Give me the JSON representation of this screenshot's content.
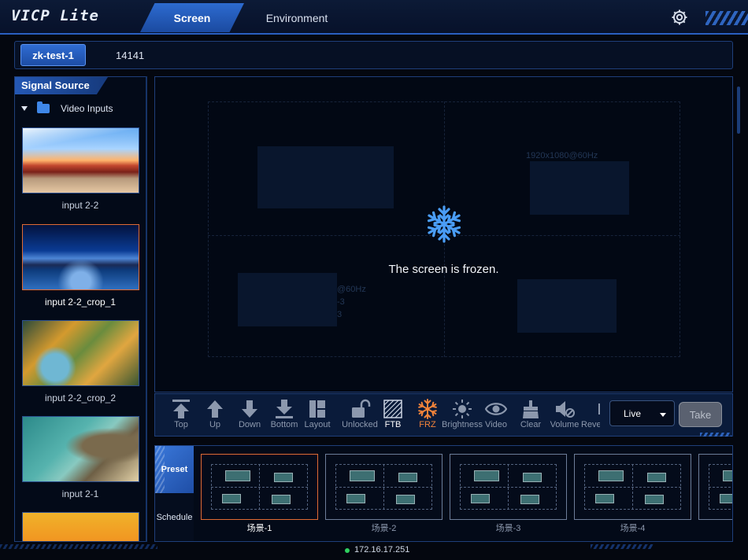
{
  "app": {
    "logo": "VICP Lite",
    "tabs": [
      {
        "label": "Screen",
        "active": true
      },
      {
        "label": "Environment",
        "active": false
      }
    ],
    "settings_icon": "gear-icon",
    "accent_color": "#2d6bd0"
  },
  "devices": {
    "active": "zk-test-1",
    "other": "14141"
  },
  "signal_source": {
    "title": "Signal Source",
    "folder": {
      "label": "Video Inputs",
      "icon": "folder-icon",
      "expanded": true
    },
    "inputs": [
      {
        "label": "input 2-2",
        "selected": false
      },
      {
        "label": "input 2-2_crop_1",
        "selected": true
      },
      {
        "label": "input 2-2_crop_2",
        "selected": false
      },
      {
        "label": "input 2-1",
        "selected": false
      }
    ]
  },
  "canvas": {
    "frozen_message": "The screen is frozen.",
    "ghost_texts": [
      "1920x1080@60Hz",
      "@60Hz",
      "-3",
      "3"
    ]
  },
  "toolbar": {
    "tools": [
      {
        "label": "Top",
        "icon": "move-top-icon"
      },
      {
        "label": "Up",
        "icon": "move-up-icon"
      },
      {
        "label": "Down",
        "icon": "move-down-icon"
      },
      {
        "label": "Bottom",
        "icon": "move-bottom-icon"
      },
      {
        "label": "Layout",
        "icon": "layout-icon"
      },
      {
        "label": "Unlocked",
        "icon": "unlock-icon"
      },
      {
        "label": "FTB",
        "icon": "ftb-icon"
      },
      {
        "label": "FRZ",
        "icon": "snowflake-icon"
      },
      {
        "label": "Brightness",
        "icon": "brightness-icon"
      },
      {
        "label": "Video",
        "icon": "eye-icon"
      },
      {
        "label": "Clear",
        "icon": "clear-icon"
      },
      {
        "label": "Volume",
        "icon": "volume-mute-icon"
      },
      {
        "label": "Reve",
        "icon": "reverse-icon"
      }
    ],
    "mode_select": "Live",
    "take_label": "Take"
  },
  "presets": {
    "tabs": [
      {
        "label": "Preset",
        "active": true
      },
      {
        "label": "Schedule",
        "active": false
      }
    ],
    "items": [
      {
        "label": "场景-1",
        "selected": true
      },
      {
        "label": "场景-2",
        "selected": false
      },
      {
        "label": "场景-3",
        "selected": false
      },
      {
        "label": "场景-4",
        "selected": false
      }
    ]
  },
  "status": {
    "ip": "172.16.17.251",
    "connected_color": "#2fd05f"
  }
}
